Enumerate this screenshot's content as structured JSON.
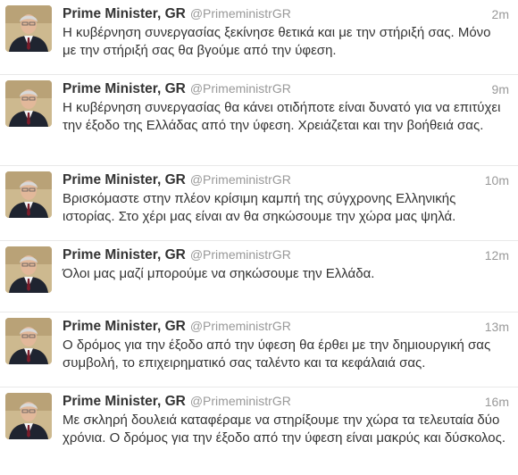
{
  "colors": {
    "text": "#333333",
    "muted": "#999999",
    "divider": "#e8e8e8",
    "background": "#ffffff"
  },
  "tweets": [
    {
      "name": "Prime Minister, GR",
      "handle": "@PrimeministrGR",
      "time": "2m",
      "text": "Η κυβέρνηση συνεργασίας ξεκίνησε θετικά και με την στήριξή σας. Μόνο με την στήριξή σας θα βγούμε από την ύφεση."
    },
    {
      "name": "Prime Minister, GR",
      "handle": "@PrimeministrGR",
      "time": "9m",
      "text": "Η κυβέρνηση συνεργασίας θα κάνει οτιδήποτε είναι δυνατό για να επιτύχει την έξοδο της Ελλάδας από την ύφεση. Χρειάζεται και την βοήθειά σας."
    },
    {
      "name": "Prime Minister, GR",
      "handle": "@PrimeministrGR",
      "time": "10m",
      "text": "Βρισκόμαστε στην πλέον κρίσιμη καμπή της σύγχρονης Ελληνικής ιστορίας. Στο χέρι μας είναι αν θα σηκώσουμε την χώρα μας ψηλά."
    },
    {
      "name": "Prime Minister, GR",
      "handle": "@PrimeministrGR",
      "time": "12m",
      "text": "Όλοι μας μαζί μπορούμε να σηκώσουμε την Ελλάδα."
    },
    {
      "name": "Prime Minister, GR",
      "handle": "@PrimeministrGR",
      "time": "13m",
      "text": "Ο δρόμος για την έξοδο από την ύφεση θα έρθει με την δημιουργική σας συμβολή, το επιχειρηματικό σας ταλέντο και τα κεφάλαιά σας."
    },
    {
      "name": "Prime Minister, GR",
      "handle": "@PrimeministrGR",
      "time": "16m",
      "text": "Με σκληρή δουλειά καταφέραμε να στηρίξουμε την χώρα τα τελευταία δύο χρόνια. Ο δρόμος για την έξοδο από την ύφεση είναι μακρύς και δύσκολος."
    }
  ]
}
